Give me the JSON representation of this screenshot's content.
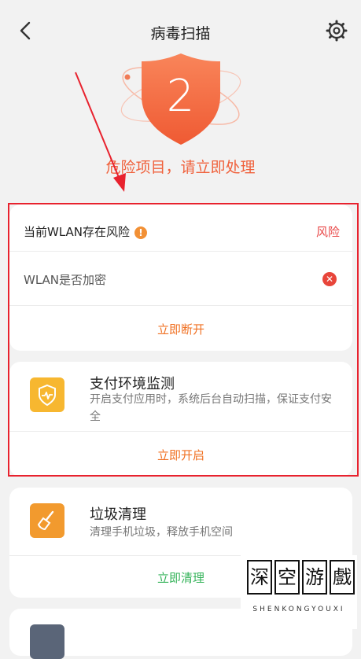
{
  "header": {
    "title": "病毒扫描",
    "back_icon": "chevron-left-icon",
    "settings_icon": "gear-icon"
  },
  "hero": {
    "count": "2",
    "message": "危险项目，请立即处理",
    "shield_color": "#f36b3f"
  },
  "wlan_card": {
    "title": "当前WLAN存在风险",
    "warning_glyph": "!",
    "status": "风险",
    "check_label": "WLAN是否加密",
    "check_status_glyph": "✕",
    "action": "立即断开"
  },
  "payment_card": {
    "title": "支付环境监测",
    "description": "开启支付应用时，系统后台自动扫描，保证支付安全",
    "action": "立即开启",
    "icon": "shield-heartbeat-icon",
    "icon_color": "#f7b730"
  },
  "cleanup_card": {
    "title": "垃圾清理",
    "description": "清理手机垃圾，释放手机空间",
    "action": "立即清理",
    "icon": "broom-icon",
    "icon_color": "#f29a2e"
  },
  "watermark": {
    "chars": [
      "深",
      "空",
      "游",
      "戲"
    ],
    "subtitle": "SHENKONGYOUXI"
  },
  "colors": {
    "danger": "#e84545",
    "accent_orange": "#f07022",
    "accent_green": "#35b35a",
    "highlight_box": "#e8222e"
  }
}
